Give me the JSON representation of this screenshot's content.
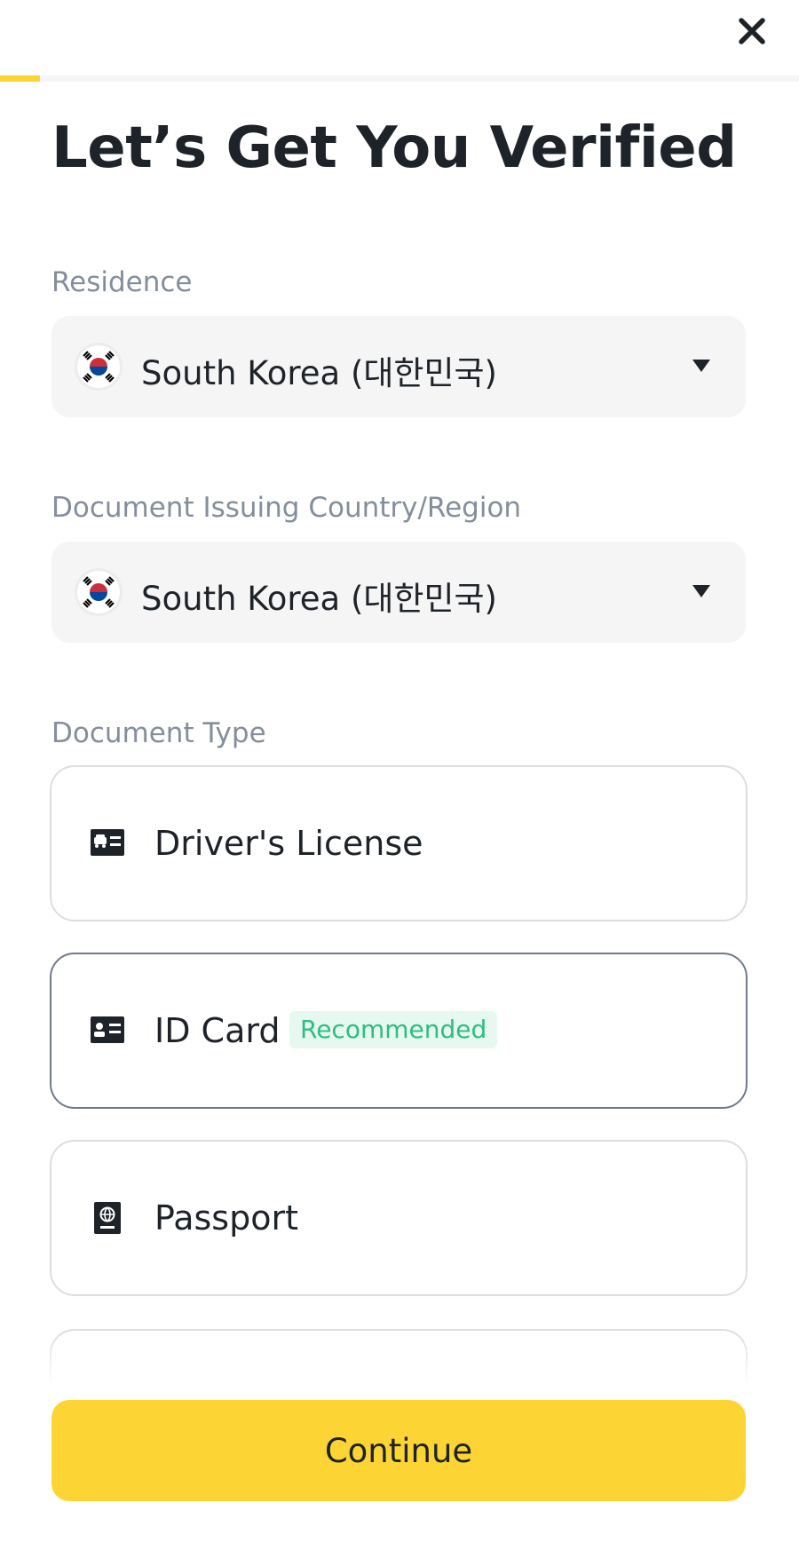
{
  "header": {
    "close_icon": "close-icon",
    "progress": 0.05
  },
  "title": "Let’s Get You Verified",
  "residence": {
    "label": "Residence",
    "value": "South Korea (대한민국)",
    "flag_icon": "south-korea-flag-icon"
  },
  "issuing_country": {
    "label": "Document Issuing Country/Region",
    "value": "South Korea (대한민국)",
    "flag_icon": "south-korea-flag-icon"
  },
  "document_type": {
    "label": "Document Type",
    "options": [
      {
        "label": "Driver's License",
        "icon": "driver-license-icon",
        "selected": false
      },
      {
        "label": "ID Card",
        "icon": "id-card-icon",
        "badge": "Recommended",
        "selected": true
      },
      {
        "label": "Passport",
        "icon": "passport-icon",
        "selected": false
      }
    ]
  },
  "continue_label": "Continue",
  "colors": {
    "accent": "#fcd535",
    "badge_bg": "#e7f8f1",
    "badge_text": "#2ebd85",
    "label": "#848e9c",
    "text": "#1e2329"
  }
}
